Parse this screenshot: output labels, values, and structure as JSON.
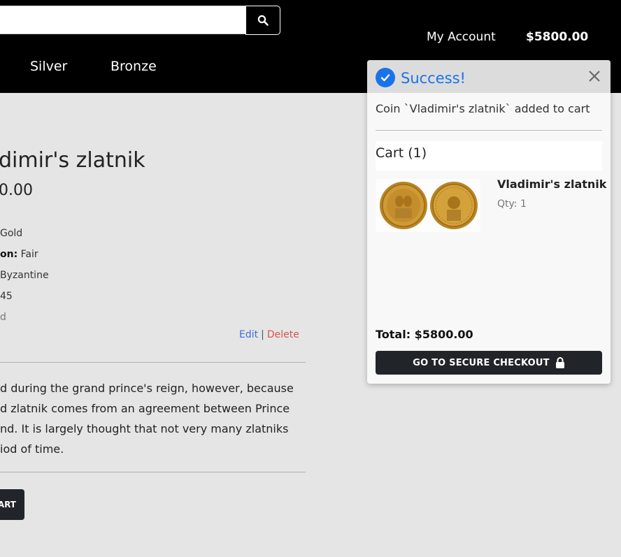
{
  "header": {
    "search_placeholder": "",
    "account_label": "My Account",
    "cart_total": "$5800.00",
    "nav": [
      "Silver",
      "Bronze"
    ]
  },
  "product": {
    "title": "dimir's zlatnik",
    "price": "0.00",
    "attributes": [
      {
        "label": "",
        "value": "Gold"
      },
      {
        "label": "on:",
        "value": " Fair"
      },
      {
        "label": "",
        "value": "Byzantine"
      },
      {
        "label": "",
        "value": "45"
      },
      {
        "label": "",
        "value": "d"
      }
    ],
    "edit_label": "Edit",
    "separator": "|",
    "delete_label": "Delete",
    "description_lines": [
      "d during the grand prince's reign, however, because",
      "d zlatnik comes from an agreement between Prince",
      "nd. It is largely thought that not very many zlatniks",
      "iod of time."
    ],
    "add_to_cart_label": "ART"
  },
  "popup": {
    "title": "Success!",
    "message": "Coin `Vladimir's zlatnik` added to cart",
    "cart_label": "Cart (1)",
    "item_name": "Vladimir's zlatnik",
    "item_qty": "Qty: 1",
    "total_label": "Total: $5800.00",
    "checkout_label": "GO TO SECURE CHECKOUT"
  },
  "colors": {
    "accent": "#1a73e8",
    "dark": "#212529",
    "delete": "#d9534f",
    "edit": "#3b6fd8"
  }
}
